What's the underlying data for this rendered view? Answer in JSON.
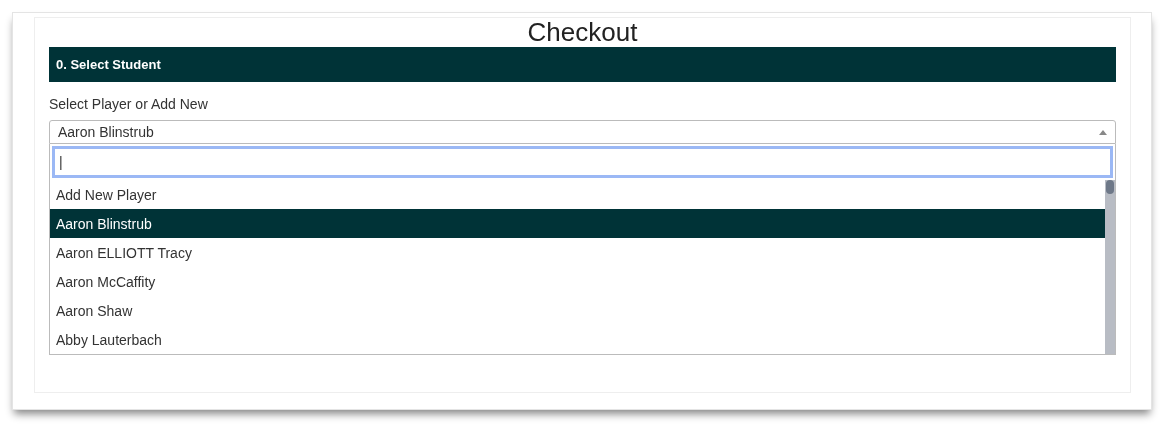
{
  "page": {
    "title": "Checkout"
  },
  "section": {
    "title": "0. Select Student"
  },
  "field": {
    "label": "Select Player or Add New",
    "value": "Aaron Blinstrub",
    "expanded": true
  },
  "search": {
    "value": "|"
  },
  "options": [
    {
      "label": "Add New Player",
      "selected": false
    },
    {
      "label": "Aaron Blinstrub",
      "selected": true
    },
    {
      "label": "Aaron ELLIOTT Tracy",
      "selected": false
    },
    {
      "label": "Aaron McCaffity",
      "selected": false
    },
    {
      "label": "Aaron Shaw",
      "selected": false
    },
    {
      "label": "Abby Lauterbach",
      "selected": false
    }
  ]
}
